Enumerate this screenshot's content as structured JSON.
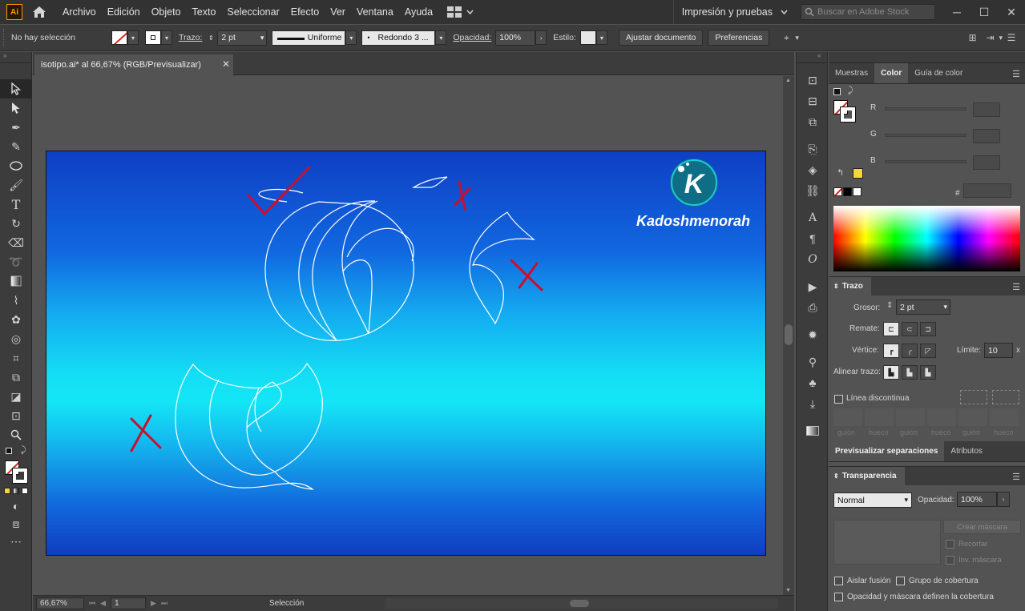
{
  "app": {
    "logo_text": "Ai"
  },
  "menu": {
    "items": [
      "Archivo",
      "Edición",
      "Objeto",
      "Texto",
      "Seleccionar",
      "Efecto",
      "Ver",
      "Ventana",
      "Ayuda"
    ],
    "workspace": "Impresión y pruebas",
    "stock_search_placeholder": "Buscar en Adobe Stock"
  },
  "controlbar": {
    "selection_status": "No hay selección",
    "stroke_label": "Trazo:",
    "stroke_weight": "2 pt",
    "profile": "Uniforme",
    "brush": "Redondo 3 ...",
    "opacity_label": "Opacidad:",
    "opacity_value": "100%",
    "style_label": "Estilo:",
    "fit_button": "Ajustar documento",
    "prefs_button": "Preferencias"
  },
  "document": {
    "tab_title": "isotipo.ai* al 66,67% (RGB/Previsualizar)",
    "brand_letter": "K",
    "brand_name": "Kadoshmenorah"
  },
  "statusbar": {
    "zoom": "66,67%",
    "page": "1",
    "status": "Selección"
  },
  "panels": {
    "top_tabs": [
      "Muestras",
      "Color",
      "Guía de color"
    ],
    "active_top_tab": "Color",
    "color": {
      "r_label": "R",
      "g_label": "G",
      "b_label": "B",
      "hex_label": "#"
    },
    "stroke": {
      "title": "Trazo",
      "weight_label": "Grosor:",
      "weight_value": "2 pt",
      "cap_label": "Remate:",
      "corner_label": "Vértice:",
      "limit_label": "Límite:",
      "limit_value": "10",
      "limit_unit": "x",
      "align_label": "Alinear trazo:",
      "dashed_label": "Línea discontinua",
      "dash_labels": [
        "guión",
        "hueco",
        "guión",
        "hueco",
        "guión",
        "hueco"
      ]
    },
    "mid_tabs": [
      "Previsualizar separaciones",
      "Atributos"
    ],
    "transparency": {
      "title": "Transparencia",
      "blend_mode": "Normal",
      "opacity_label": "Opacidad:",
      "opacity_value": "100%",
      "mask_button": "Crear máscara",
      "clip_label": "Recortar",
      "invert_label": "Inv. máscara",
      "isolate_label": "Aislar fusión",
      "knockout_label": "Grupo de cobertura",
      "opacity_mask_label": "Opacidad y máscara definen la cobertura"
    }
  },
  "colors": {
    "annotation_red": "#c8102e",
    "sketch_white": "#ffffff",
    "swatch_yellow": "#f4d935"
  }
}
